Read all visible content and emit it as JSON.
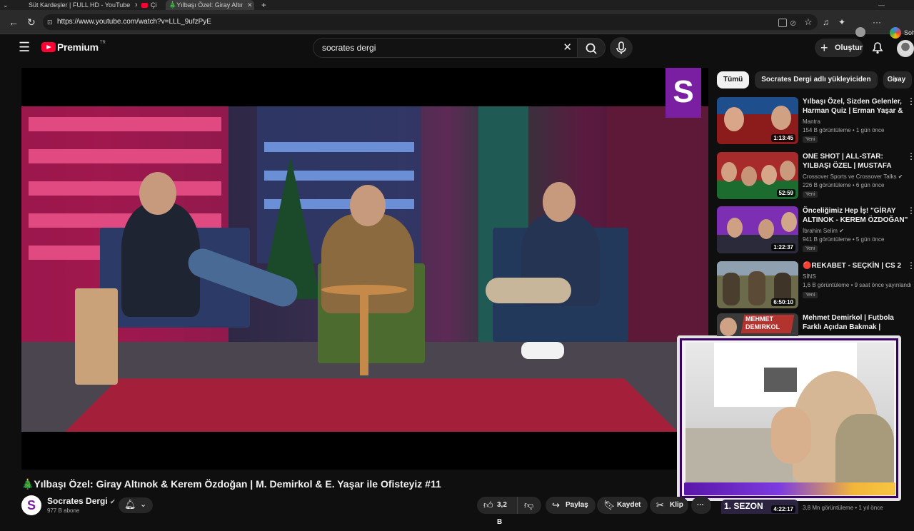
{
  "browser": {
    "tabs": [
      {
        "label": "Süt Kardeşler | FULL HD - YouTube",
        "active": false
      },
      {
        "label": "Çi",
        "active": false
      },
      {
        "label": "🎄Yılbaşı Özel: Giray Altınok",
        "active": true
      }
    ],
    "new_tab": "+",
    "url": "https://www.youtube.com/watch?v=LLL_9ufzPyE",
    "right_label": "Soh"
  },
  "header": {
    "logo_text": "Premium",
    "logo_sup": "TR",
    "search_value": "socrates dergi",
    "create_label": "Oluştur"
  },
  "player": {
    "channel_badge": "S"
  },
  "video": {
    "title": "🎄Yılbaşı Özel: Giray Altınok & Kerem Özdoğan | M. Demirkol & E. Yaşar ile Ofisteyiz #11",
    "channel": "Socrates Dergi",
    "subs": "977 B abone",
    "likes": "3,2 B",
    "share": "Paylaş",
    "save": "Kaydet",
    "clip": "Klip",
    "more": "···"
  },
  "sidebar": {
    "chips": [
      "Tümü",
      "Socrates Dergi adlı yükleyiciden",
      "Giray"
    ],
    "recs": [
      {
        "title": "Yılbaşı Özel, Sizden Gelenler, Harman Quiz | Erman Yaşar & ...",
        "channel": "Mantra",
        "meta": "154 B görüntüleme • 1 gün önce",
        "badge": "Yeni",
        "duration": "1:13:45",
        "thumb_color": "#8c1c1c"
      },
      {
        "title": "ONE SHOT | ALL-STAR: YILBAŞI ÖZEL | MUSTAFA DEMİRTAŞ, ...",
        "channel": "Crossover Sports ve Crossover Talks",
        "meta": "226 B görüntüleme • 6 gün önce",
        "badge": "Yeni",
        "duration": "52:59",
        "thumb_color": "#a72b2b"
      },
      {
        "title": "Önceliğimiz Hep İş! \"GİRAY ALTINOK - KEREM ÖZDOĞAN\" ...",
        "channel": "İbrahim Selim",
        "meta": "941 B görüntüleme • 5 gün önce",
        "badge": "Yeni",
        "duration": "1:22:37",
        "thumb_color": "#7d2fb4"
      },
      {
        "title": "🔴REKABET - SEÇKİN | CS 2",
        "channel": "SİNS",
        "meta": "1,6 B görüntüleme • 9 saat önce yayınlandı",
        "badge": "Yeni",
        "duration": "6:50:10",
        "thumb_color": "#6b6a4a"
      },
      {
        "title": "Mehmet Demirkol | Futbola Farklı Açıdan Bakmak | Kimsin...",
        "channel": "",
        "meta": "",
        "badge": "",
        "duration": "",
        "thumb_color": "#b3342f",
        "thumb_text": "MEHMET DEMIRKOL"
      },
      {
        "title": "",
        "channel": "",
        "meta": "3,8 Mn görüntüleme • 1 yıl önce",
        "badge": "",
        "duration": "4:22:17",
        "thumb_color": "#2b2340",
        "thumb_text": "1. SEZON"
      }
    ]
  },
  "colors": {
    "accent": "#ff0033",
    "brand_purple": "#7b1fa2",
    "bg": "#0f0f0f"
  }
}
